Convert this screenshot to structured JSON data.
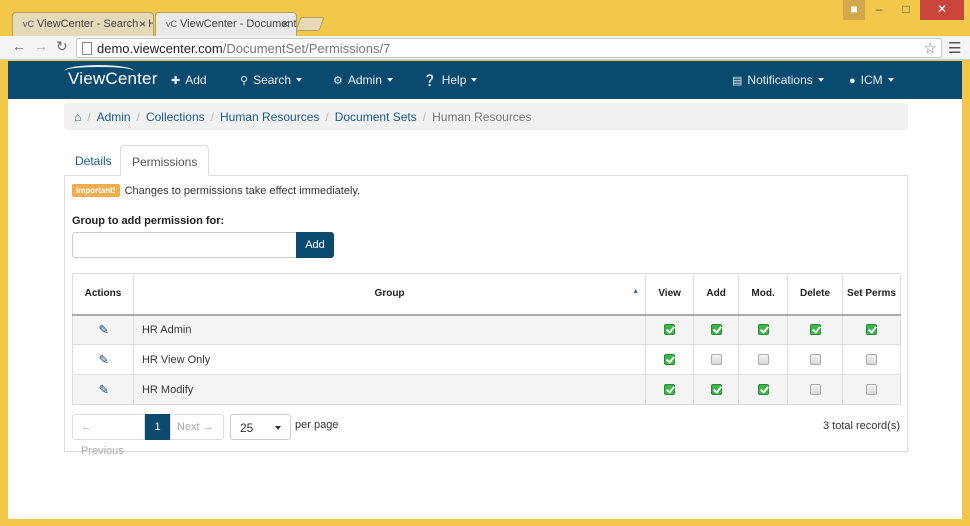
{
  "browser": {
    "tabs": [
      {
        "icon": "vC",
        "title": "ViewCenter - Search - Hu"
      },
      {
        "icon": "vC",
        "title": "ViewCenter - Document S"
      }
    ],
    "url_host": "demo.viewcenter.com",
    "url_path": "/DocumentSet/Permissions/7"
  },
  "navbar": {
    "brand": "ViewCenter",
    "add": "Add",
    "search": "Search",
    "admin": "Admin",
    "help": "Help",
    "notifications": "Notifications",
    "user": "ICM"
  },
  "breadcrumb": [
    "Admin",
    "Collections",
    "Human Resources",
    "Document Sets",
    "Human Resources"
  ],
  "tabs": {
    "details": "Details",
    "permissions": "Permissions"
  },
  "notice": {
    "badge": "Important!",
    "text": "Changes to permissions take effect immediately."
  },
  "add_group": {
    "label": "Group to add permission for:",
    "input_value": "",
    "button": "Add"
  },
  "table": {
    "headers": {
      "actions": "Actions",
      "group": "Group",
      "view": "View",
      "add": "Add",
      "mod": "Mod.",
      "delete": "Delete",
      "set_perms": "Set Perms"
    },
    "rows": [
      {
        "group": "HR Admin",
        "view": true,
        "add": true,
        "mod": true,
        "delete": true,
        "set_perms": true
      },
      {
        "group": "HR View Only",
        "view": true,
        "add": false,
        "mod": false,
        "delete": false,
        "set_perms": false
      },
      {
        "group": "HR Modify",
        "view": true,
        "add": true,
        "mod": true,
        "delete": false,
        "set_perms": false
      }
    ]
  },
  "pagination": {
    "previous": "← Previous",
    "current": "1",
    "next": "Next →",
    "per_page_value": "25",
    "per_page_label": "per page",
    "total": "3 total record(s)"
  },
  "colors": {
    "navbar": "#0b4a6f",
    "link": "#1b5a86",
    "badge": "#f0ad4e",
    "check": "#3cb54a"
  }
}
